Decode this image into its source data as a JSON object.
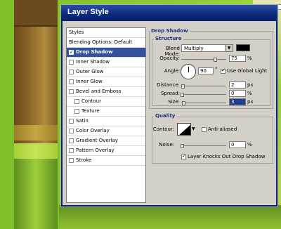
{
  "window": {
    "title": "Layer Style"
  },
  "styles_list": {
    "header": "Styles",
    "items": [
      {
        "label": "Blending Options: Default",
        "checkbox": false
      },
      {
        "label": "Drop Shadow",
        "checkbox": true,
        "selected": true
      },
      {
        "label": "Inner Shadow",
        "checkbox": true
      },
      {
        "label": "Outer Glow",
        "checkbox": true
      },
      {
        "label": "Inner Glow",
        "checkbox": true
      },
      {
        "label": "Bevel and Emboss",
        "checkbox": true
      },
      {
        "label": "Contour",
        "checkbox": true,
        "indent": true
      },
      {
        "label": "Texture",
        "checkbox": true,
        "indent": true
      },
      {
        "label": "Satin",
        "checkbox": true
      },
      {
        "label": "Color Overlay",
        "checkbox": true
      },
      {
        "label": "Gradient Overlay",
        "checkbox": true
      },
      {
        "label": "Pattern Overlay",
        "checkbox": true
      },
      {
        "label": "Stroke",
        "checkbox": true
      }
    ]
  },
  "drop_shadow": {
    "section_title": "Drop Shadow",
    "structure_title": "Structure",
    "blend_mode_label": "Blend Mode:",
    "blend_mode_value": "Multiply",
    "shadow_color": "#000000",
    "opacity_label": "Opacity:",
    "opacity_value": "75",
    "opacity_unit": "%",
    "angle_label": "Angle:",
    "angle_value": "90",
    "angle_unit": "°",
    "use_global_light_label": "Use Global Light",
    "use_global_light_checked": true,
    "distance_label": "Distance:",
    "distance_value": "2",
    "distance_unit": "px",
    "spread_label": "Spread:",
    "spread_value": "0",
    "spread_unit": "%",
    "size_label": "Size:",
    "size_value": "3",
    "size_unit": "px"
  },
  "quality": {
    "title": "Quality",
    "contour_label": "Contour:",
    "anti_aliased_label": "Anti-aliased",
    "anti_aliased_checked": false,
    "noise_label": "Noise:",
    "noise_value": "0",
    "noise_unit": "%",
    "knockout_label": "Layer Knocks Out Drop Shadow",
    "knockout_checked": true
  }
}
